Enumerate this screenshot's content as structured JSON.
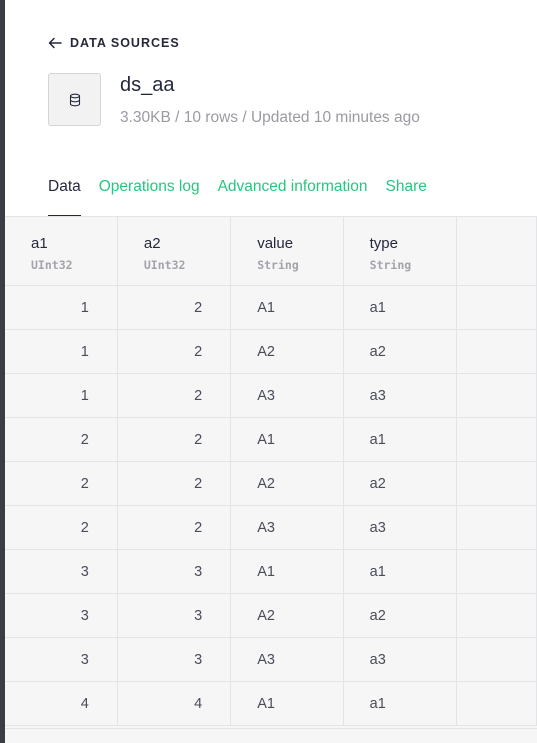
{
  "nav": {
    "back_label": "DATA SOURCES"
  },
  "datasource": {
    "name": "ds_aa",
    "meta": "3.30KB / 10 rows / Updated 10 minutes ago"
  },
  "tabs": [
    {
      "label": "Data",
      "active": true
    },
    {
      "label": "Operations log",
      "active": false
    },
    {
      "label": "Advanced information",
      "active": false
    },
    {
      "label": "Share",
      "active": false
    }
  ],
  "colors": {
    "accent": "#27c67f",
    "text": "#25283d",
    "muted": "#9a9ba1"
  },
  "table": {
    "columns": [
      {
        "name": "a1",
        "type": "UInt32"
      },
      {
        "name": "a2",
        "type": "UInt32"
      },
      {
        "name": "value",
        "type": "String"
      },
      {
        "name": "type",
        "type": "String"
      }
    ],
    "rows": [
      [
        "1",
        "2",
        "A1",
        "a1"
      ],
      [
        "1",
        "2",
        "A2",
        "a2"
      ],
      [
        "1",
        "2",
        "A3",
        "a3"
      ],
      [
        "2",
        "2",
        "A1",
        "a1"
      ],
      [
        "2",
        "2",
        "A2",
        "a2"
      ],
      [
        "2",
        "2",
        "A3",
        "a3"
      ],
      [
        "3",
        "3",
        "A1",
        "a1"
      ],
      [
        "3",
        "3",
        "A2",
        "a2"
      ],
      [
        "3",
        "3",
        "A3",
        "a3"
      ],
      [
        "4",
        "4",
        "A1",
        "a1"
      ]
    ]
  }
}
